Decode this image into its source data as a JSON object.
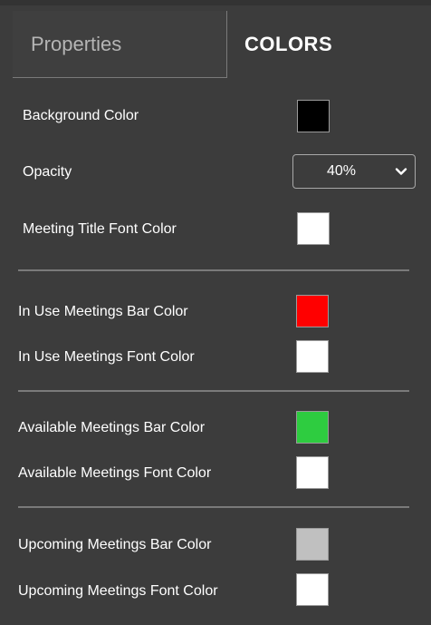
{
  "tabs": {
    "properties_label": "Properties",
    "colors_label": "COLORS",
    "active": "COLORS"
  },
  "settings": {
    "background_color": {
      "label": "Background Color",
      "value": "#000000"
    },
    "opacity": {
      "label": "Opacity",
      "selected": "40%"
    },
    "meeting_title_font_color": {
      "label": "Meeting Title Font Color",
      "value": "#ffffff"
    },
    "in_use_bar_color": {
      "label": "In Use Meetings Bar Color",
      "value": "#ff0000"
    },
    "in_use_font_color": {
      "label": "In Use Meetings Font Color",
      "value": "#ffffff"
    },
    "available_bar_color": {
      "label": "Available Meetings Bar Color",
      "value": "#2ecc40"
    },
    "available_font_color": {
      "label": "Available Meetings Font Color",
      "value": "#ffffff"
    },
    "upcoming_bar_color": {
      "label": "Upcoming Meetings Bar Color",
      "value": "#c0c0c0"
    },
    "upcoming_font_color": {
      "label": "Upcoming Meetings Font Color",
      "value": "#ffffff"
    }
  },
  "icons": {
    "select_arrow": "chevron-down-icon"
  }
}
